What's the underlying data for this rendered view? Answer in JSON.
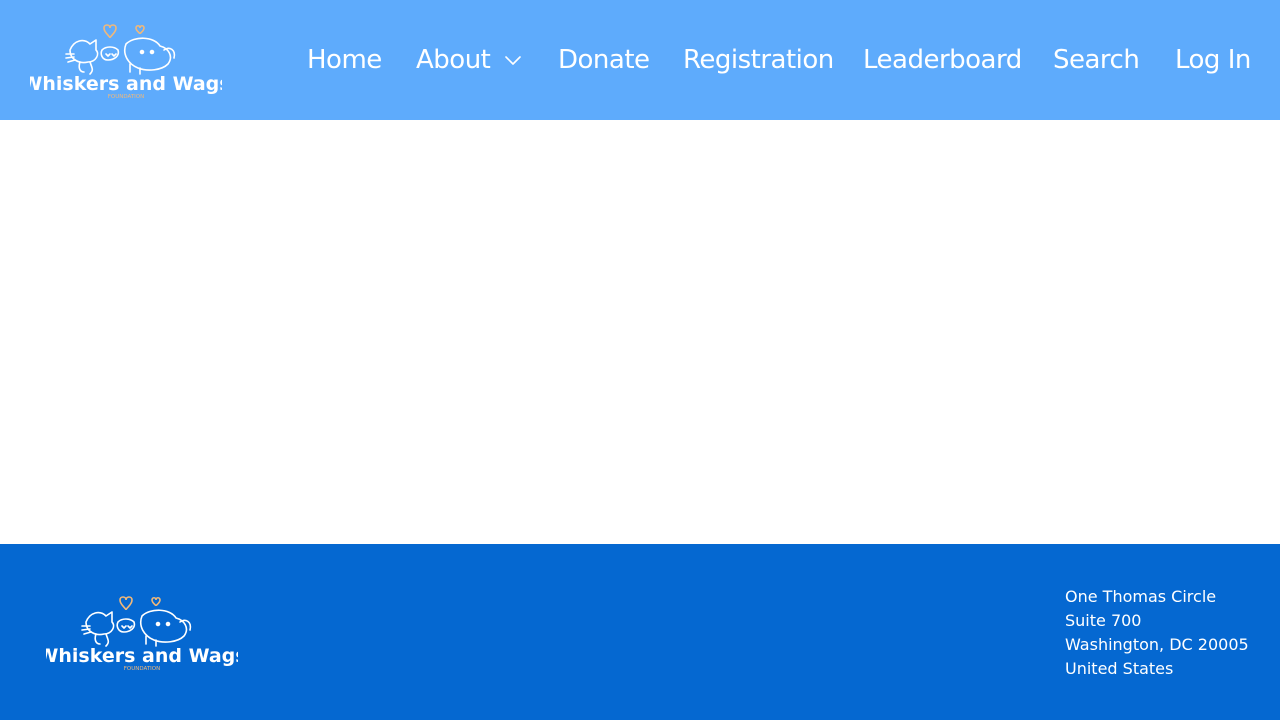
{
  "brand": {
    "name": "Whiskers and Wags",
    "tagline": "FOUNDATION",
    "colors": {
      "header_bg": "#5eabfc",
      "footer_bg": "#0568d1",
      "heart": "#f0b87a",
      "text": "#ffffff"
    }
  },
  "nav": {
    "items": [
      {
        "label": "Home"
      },
      {
        "label": "About",
        "has_dropdown": true,
        "icon": "chevron-down-icon"
      },
      {
        "label": "Donate"
      },
      {
        "label": "Registration"
      },
      {
        "label": "Leaderboard"
      },
      {
        "label": "Search"
      },
      {
        "label": "Log In"
      }
    ]
  },
  "footer": {
    "address": {
      "line1": "One Thomas Circle",
      "line2": "Suite 700",
      "line3": "Washington, DC 20005",
      "line4": "United States"
    }
  }
}
